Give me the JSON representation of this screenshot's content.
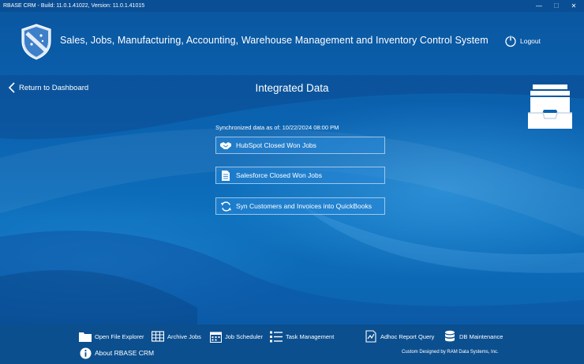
{
  "window": {
    "title": "RBASE CRM - Build: 11.0.1.41022, Version: 11.0.1.41015",
    "controls": [
      "—",
      "☐",
      "✕"
    ]
  },
  "header": {
    "app_title": "Sales, Jobs, Manufacturing, Accounting, Warehouse Management and Inventory Control System",
    "logout_label": "Logout"
  },
  "nav": {
    "back_label": "Return to Dashboard",
    "page_title": "Integrated Data"
  },
  "main": {
    "sync_text": "Synchronized data as of: 10/22/2024 08:00 PM",
    "buttons": [
      {
        "label": "HubSpot Closed Won Jobs",
        "icon": "handshake-icon"
      },
      {
        "label": "Salesforce Closed Won Jobs",
        "icon": "document-icon"
      },
      {
        "label": "Syn Customers and Invoices into QuickBooks",
        "icon": "sync-icon"
      }
    ]
  },
  "footer": {
    "items": [
      {
        "label": "Open File Explorer",
        "icon": "folder-icon"
      },
      {
        "label": "Archive Jobs",
        "icon": "archive-grid-icon"
      },
      {
        "label": "Job Scheduler",
        "icon": "calendar-icon"
      },
      {
        "label": "Task Management",
        "icon": "task-list-icon"
      },
      {
        "label": "Adhoc Report Query",
        "icon": "report-icon"
      },
      {
        "label": "DB Maintenance",
        "icon": "database-icon"
      },
      {
        "label": "About RBASE CRM",
        "icon": "info-icon"
      }
    ],
    "credit": "Custom Designed by RAM Data Systems, Inc."
  },
  "colors": {
    "background": "#0b63b0",
    "titlebar": "#0a4f95",
    "footer": "#0b4f8f",
    "text": "#ffffff"
  }
}
